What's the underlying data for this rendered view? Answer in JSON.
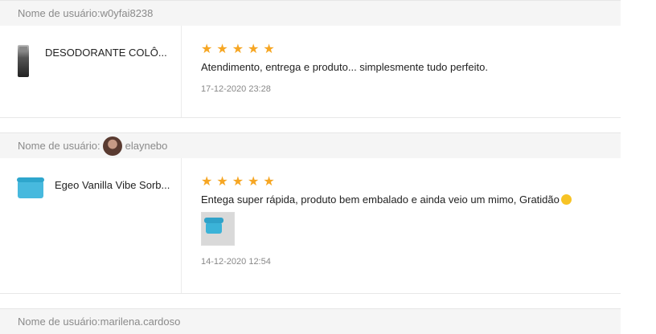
{
  "reviews": [
    {
      "user_label": "Nome de usuário:",
      "username": "w0yfai8238",
      "product_name": "DESODORANTE COLÔ...",
      "rating": 5,
      "comment": "Atendimento, entrega e produto... simplesmente tudo perfeito.",
      "date": "17-12-2020 23:28"
    },
    {
      "user_label": "Nome de usuário:",
      "username": "elaynebo",
      "product_name": "Egeo Vanilla Vibe Sorb...",
      "rating": 5,
      "comment": "Entega super rápida, produto bem embalado e ainda veio um mimo, Gratidão",
      "date": "14-12-2020 12:54"
    },
    {
      "user_label": "Nome de usuário:",
      "username": "marilena.cardoso"
    }
  ],
  "colors": {
    "star": "#f6a623",
    "bar_bg": "#f5f5f5"
  }
}
